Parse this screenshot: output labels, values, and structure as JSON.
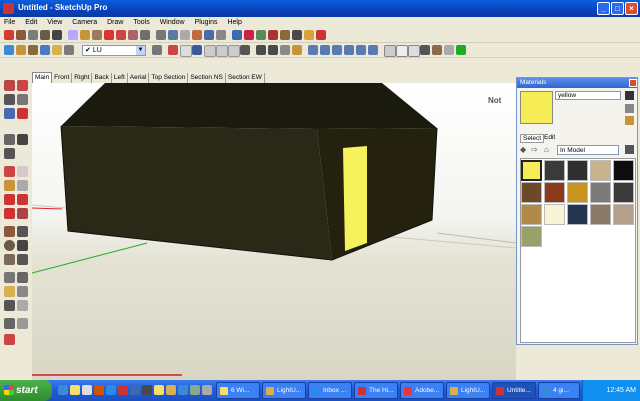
{
  "window": {
    "title": "Untitled - SketchUp Pro"
  },
  "menu": [
    "File",
    "Edit",
    "View",
    "Camera",
    "Draw",
    "Tools",
    "Window",
    "Plugins",
    "Help"
  ],
  "layer": {
    "current": "LU"
  },
  "scenes": [
    "Main",
    "Front",
    "Right",
    "Back",
    "Left",
    "Aerial",
    "Top Section",
    "Section NS",
    "Section EW"
  ],
  "panel": {
    "title": "Materials",
    "material_name": "yellow",
    "tabs": [
      "Select",
      "Edit"
    ],
    "collection": "In Model",
    "swatches": [
      "#f6ec55",
      "#3a3a3a",
      "#2f2f2f",
      "#c8b38c",
      "#0d0d0d",
      "#6b4a2a",
      "#8b3a1e",
      "#c89420",
      "#7a7a7a",
      "#3b3b3b",
      "#b08a4a",
      "#f7f3d4",
      "#24354f",
      "#8a7a6a",
      "#b4a08a",
      "#9aa06a"
    ]
  },
  "overlay_text": "Not",
  "taskbar": {
    "start": "start",
    "buttons": [
      "6 Wi...",
      "LightU...",
      "Inbox ...",
      "The Hi...",
      "Adobe...",
      "LightU...",
      "Untitle...",
      "4 gi..."
    ],
    "clock": "12:45 AM"
  },
  "colors": {
    "wall": "#2a2816",
    "door": "#f5f25c",
    "roof": "#1b1a0e"
  }
}
